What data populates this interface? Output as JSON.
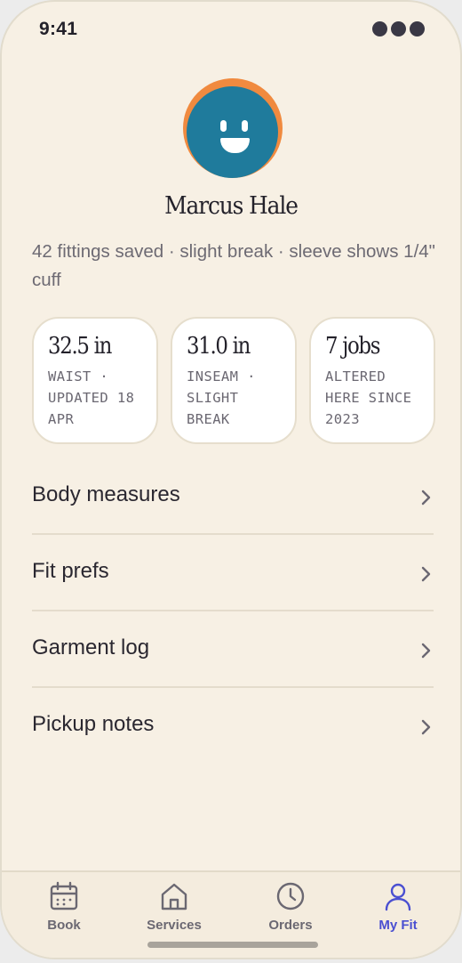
{
  "status": {
    "time": "9:41"
  },
  "colors": {
    "background": "#f7f0e4",
    "avatar_ring": "#f08a3f",
    "avatar_face": "#1f7b9c",
    "tab_active": "#4a4fd1",
    "tab_inactive": "#6b6872"
  },
  "profile": {
    "name": "Marcus Hale",
    "summary": "42 fittings saved · slight break · sleeve shows 1/4\" cuff",
    "avatar_icon": "smiley-face-icon"
  },
  "stats": [
    {
      "value": "32.5 in",
      "label": "WAIST · UPDATED 18 APR"
    },
    {
      "value": "31.0 in",
      "label": "INSEAM · SLIGHT BREAK"
    },
    {
      "value": "7 jobs",
      "label": "ALTERED HERE SINCE 2023"
    }
  ],
  "menu": [
    {
      "label": "Body measures",
      "icon": "chevron-right-icon"
    },
    {
      "label": "Fit prefs",
      "icon": "chevron-right-icon"
    },
    {
      "label": "Garment log",
      "icon": "chevron-right-icon"
    },
    {
      "label": "Pickup notes",
      "icon": "chevron-right-icon"
    }
  ],
  "tabs": [
    {
      "label": "Book",
      "icon": "calendar-icon",
      "active": false
    },
    {
      "label": "Services",
      "icon": "home-icon",
      "active": false
    },
    {
      "label": "Orders",
      "icon": "clock-icon",
      "active": false
    },
    {
      "label": "My Fit",
      "icon": "person-icon",
      "active": true
    }
  ]
}
